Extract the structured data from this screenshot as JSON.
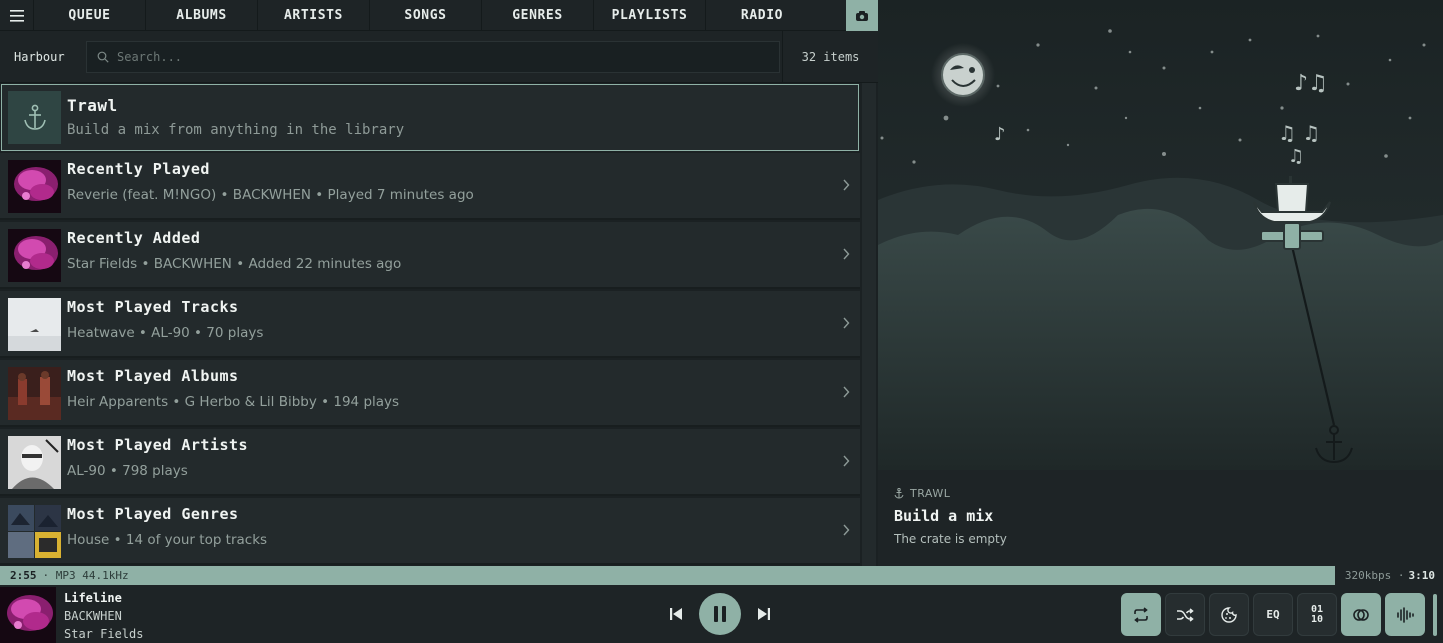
{
  "nav": {
    "tabs": [
      "QUEUE",
      "ALBUMS",
      "ARTISTS",
      "SONGS",
      "GENRES",
      "PLAYLISTS",
      "RADIO"
    ]
  },
  "search": {
    "library": "Harbour",
    "placeholder": "Search...",
    "count": "32 items"
  },
  "list": {
    "feature": {
      "title": "Trawl",
      "subtitle": "Build a mix from anything in the library"
    },
    "items": [
      {
        "title": "Recently Played",
        "subtitle": "Reverie (feat. M!NGO) • BACKWHEN • Played 7 minutes ago"
      },
      {
        "title": "Recently Added",
        "subtitle": "Star Fields • BACKWHEN • Added 22 minutes ago"
      },
      {
        "title": "Most Played Tracks",
        "subtitle": "Heatwave • AL-90 • 70 plays"
      },
      {
        "title": "Most Played Albums",
        "subtitle": "Heir Apparents • G Herbo & Lil Bibby • 194 plays"
      },
      {
        "title": "Most Played Artists",
        "subtitle": "AL-90 • 798 plays"
      },
      {
        "title": "Most Played Genres",
        "subtitle": "House • 14 of your top tracks"
      }
    ]
  },
  "panel": {
    "kicker": "TRAWL",
    "heading": "Build a mix",
    "description": "The crate is empty"
  },
  "status": {
    "elapsed": "2:55",
    "format": "· MP3 44.1kHz",
    "bitrate": "320kbps ·",
    "total": "3:10"
  },
  "now_playing": {
    "title": "Lifeline",
    "artist": "BACKWHEN",
    "album": "Star Fields"
  },
  "toolbar": {
    "eq_label": "EQ",
    "bits_label": "01\n10"
  },
  "colors": {
    "accent": "#8fb1a6",
    "background": "#1b2123",
    "row": "#232a2c"
  }
}
